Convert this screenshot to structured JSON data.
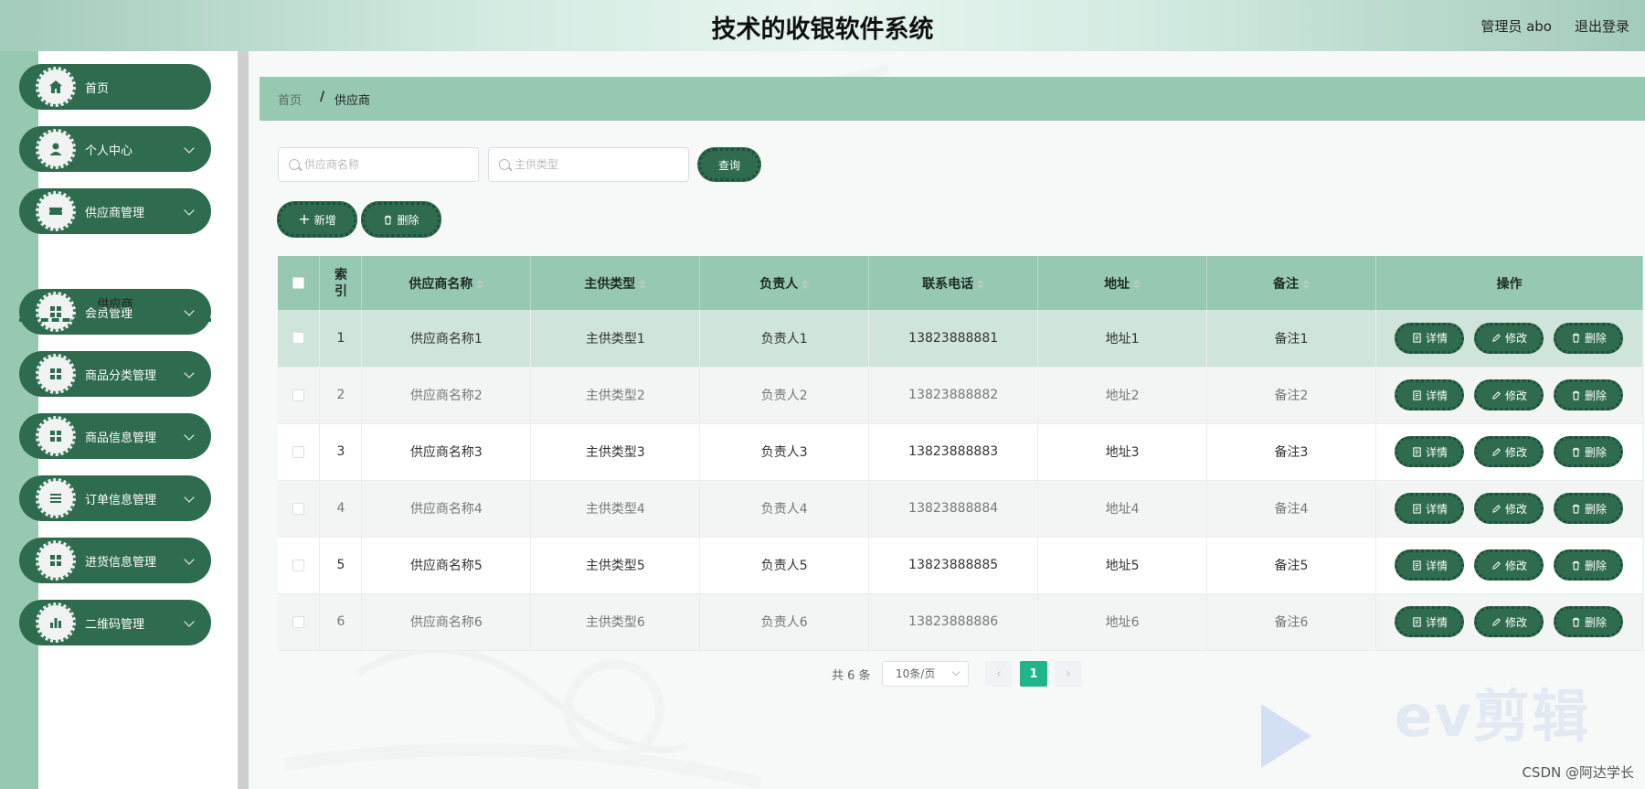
{
  "header": {
    "title": "技术的收银软件系统",
    "user": "管理员 abo",
    "logout": "退出登录"
  },
  "sidebar": {
    "items": [
      {
        "label": "首页",
        "icon": "home-icon",
        "expandable": false
      },
      {
        "label": "个人中心",
        "icon": "user-icon",
        "expandable": true
      },
      {
        "label": "供应商管理",
        "icon": "ticket-icon",
        "expandable": true
      },
      {
        "label": "会员管理",
        "icon": "grid-icon",
        "expandable": true
      },
      {
        "label": "商品分类管理",
        "icon": "grid-icon",
        "expandable": true
      },
      {
        "label": "商品信息管理",
        "icon": "grid-icon",
        "expandable": true
      },
      {
        "label": "订单信息管理",
        "icon": "list-icon",
        "expandable": true
      },
      {
        "label": "进货信息管理",
        "icon": "grid-icon",
        "expandable": true
      },
      {
        "label": "二维码管理",
        "icon": "bar-chart-icon",
        "expandable": true
      }
    ],
    "submenu": "供应商"
  },
  "breadcrumb": {
    "home": "首页",
    "separator": "/",
    "current": "供应商"
  },
  "search": {
    "name_placeholder": "供应商名称",
    "type_placeholder": "主供类型",
    "query_button": "查询"
  },
  "toolbar": {
    "add": "新增",
    "delete": "删除"
  },
  "table": {
    "headers": {
      "index": "索引",
      "name": "供应商名称",
      "type": "主供类型",
      "person": "负责人",
      "phone": "联系电话",
      "address": "地址",
      "note": "备注",
      "ops": "操作"
    },
    "rows": [
      {
        "index": "1",
        "name": "供应商名称1",
        "type": "主供类型1",
        "person": "负责人1",
        "phone": "13823888881",
        "address": "地址1",
        "note": "备注1"
      },
      {
        "index": "2",
        "name": "供应商名称2",
        "type": "主供类型2",
        "person": "负责人2",
        "phone": "13823888882",
        "address": "地址2",
        "note": "备注2"
      },
      {
        "index": "3",
        "name": "供应商名称3",
        "type": "主供类型3",
        "person": "负责人3",
        "phone": "13823888883",
        "address": "地址3",
        "note": "备注3"
      },
      {
        "index": "4",
        "name": "供应商名称4",
        "type": "主供类型4",
        "person": "负责人4",
        "phone": "13823888884",
        "address": "地址4",
        "note": "备注4"
      },
      {
        "index": "5",
        "name": "供应商名称5",
        "type": "主供类型5",
        "person": "负责人5",
        "phone": "13823888885",
        "address": "地址5",
        "note": "备注5"
      },
      {
        "index": "6",
        "name": "供应商名称6",
        "type": "主供类型6",
        "person": "负责人6",
        "phone": "13823888886",
        "address": "地址6",
        "note": "备注6"
      }
    ],
    "op_labels": {
      "detail": "详情",
      "edit": "修改",
      "delete": "删除"
    }
  },
  "pagination": {
    "total": "共 6 条",
    "page_size": "10条/页",
    "current_page": "1",
    "prev": "‹",
    "next": "›"
  },
  "watermark": {
    "ev": "ev剪辑",
    "csdn": "CSDN @阿达学长"
  },
  "colors": {
    "primary": "#2e6b4f",
    "header_bg": "#97c8b2",
    "active_page": "#20b48a"
  }
}
